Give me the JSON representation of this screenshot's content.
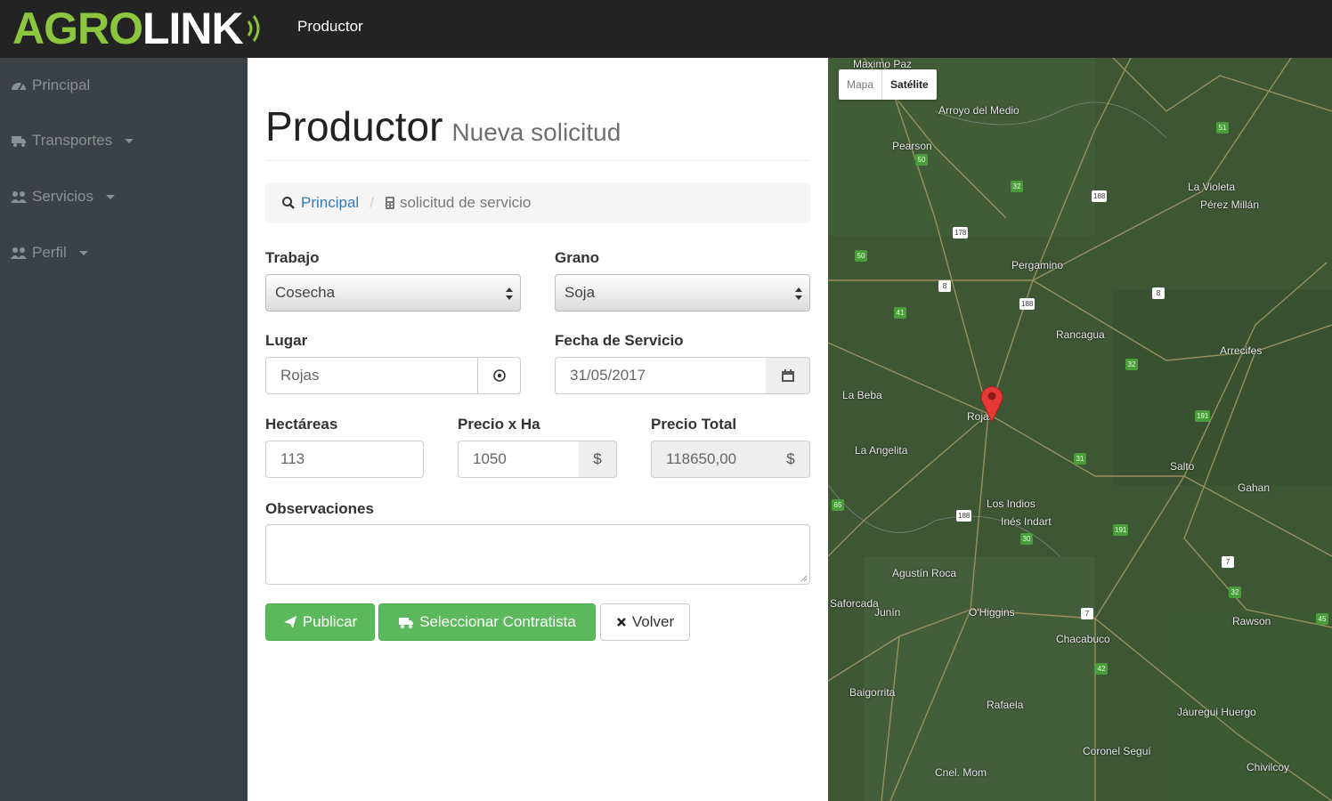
{
  "navbar": {
    "brand_agro": "AGRO",
    "brand_link": "LINK",
    "title": "Productor"
  },
  "sidebar": {
    "items": [
      {
        "label": "Principal",
        "icon": "dashboard-icon",
        "has_caret": false
      },
      {
        "label": "Transportes",
        "icon": "truck-icon",
        "has_caret": true
      },
      {
        "label": "Servicios",
        "icon": "users-icon",
        "has_caret": true
      },
      {
        "label": "Perfil",
        "icon": "users-icon",
        "has_caret": true
      }
    ]
  },
  "page_header": {
    "title": "Productor",
    "subtitle": "Nueva solicitud"
  },
  "breadcrumb": {
    "home": "Principal",
    "current": "solicitud de servicio",
    "separator": "/"
  },
  "form": {
    "trabajo": {
      "label": "Trabajo",
      "value": "Cosecha"
    },
    "grano": {
      "label": "Grano",
      "value": "Soja"
    },
    "lugar": {
      "label": "Lugar",
      "value": "Rojas"
    },
    "fecha": {
      "label": "Fecha de Servicio",
      "value": "31/05/2017"
    },
    "hectareas": {
      "label": "Hectáreas",
      "value": "113"
    },
    "precio_ha": {
      "label": "Precio x Ha",
      "value": "1050",
      "addon": "$"
    },
    "precio_total": {
      "label": "Precio Total",
      "value": "118650,00",
      "addon": "$"
    },
    "observaciones": {
      "label": "Observaciones",
      "value": ""
    }
  },
  "buttons": {
    "publicar": "Publicar",
    "seleccionar": "Seleccionar Contratista",
    "volver": "Volver"
  },
  "map": {
    "type_map": "Mapa",
    "type_satellite": "Satélite",
    "selected_type": "Satélite",
    "towns": [
      "Maximo Paz",
      "Arroyo del Medio",
      "Pearson",
      "La Violeta",
      "Pérez Millán",
      "Pergamino",
      "Rancagua",
      "Arrecifes",
      "La Beba",
      "Rojas",
      "La Angelita",
      "Los Indios",
      "Inés Indart",
      "Salto",
      "Gahan",
      "Agustín Roca",
      "Junín",
      "O'Higgins",
      "Chacabuco",
      "Rawson",
      "Saforcada",
      "Baigorrita",
      "Rafaela",
      "Jáuregui Huergo",
      "Coronel Seguí",
      "Chivilcoy",
      "Cnel. Mom"
    ],
    "routes": [
      "188",
      "178",
      "188",
      "8",
      "8",
      "188",
      "7",
      "7",
      "51",
      "32",
      "32",
      "191",
      "191",
      "31",
      "30",
      "65",
      "45",
      "41",
      "42",
      "50",
      "50",
      "32"
    ],
    "accent_color": "#e53935"
  },
  "colors": {
    "brand_green": "#8cc63f",
    "navbar_bg": "#232323",
    "sidebar_bg": "#3c4145",
    "success": "#5cb85c",
    "link": "#337ab7"
  }
}
